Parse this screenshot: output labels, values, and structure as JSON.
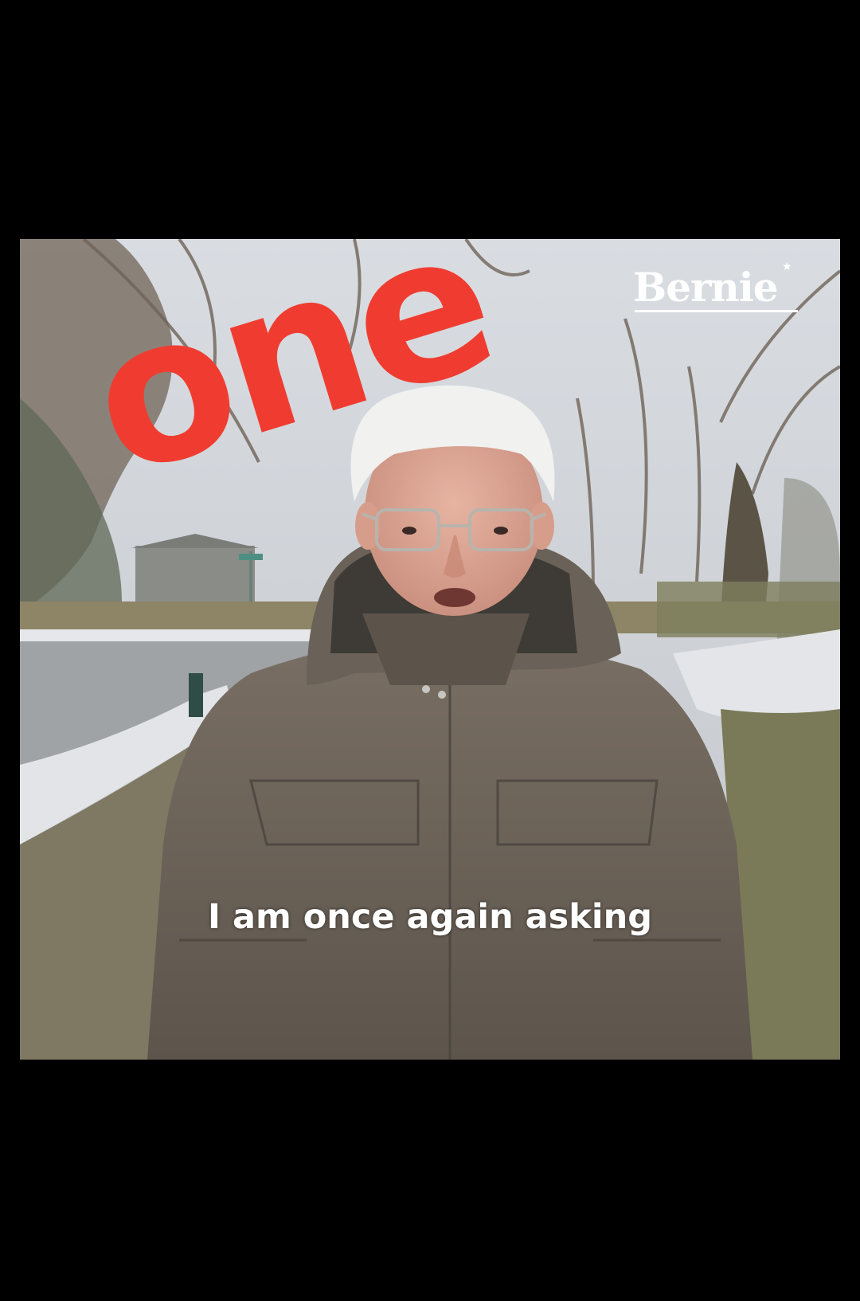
{
  "overlay": {
    "word": "one",
    "color": "#f03c30"
  },
  "brand": {
    "logo_text": "Bernie",
    "star": "★"
  },
  "caption": {
    "text": "I am once again asking"
  },
  "colors": {
    "background": "#000000",
    "caption": "#ffffff",
    "jacket": "#6e655b"
  }
}
